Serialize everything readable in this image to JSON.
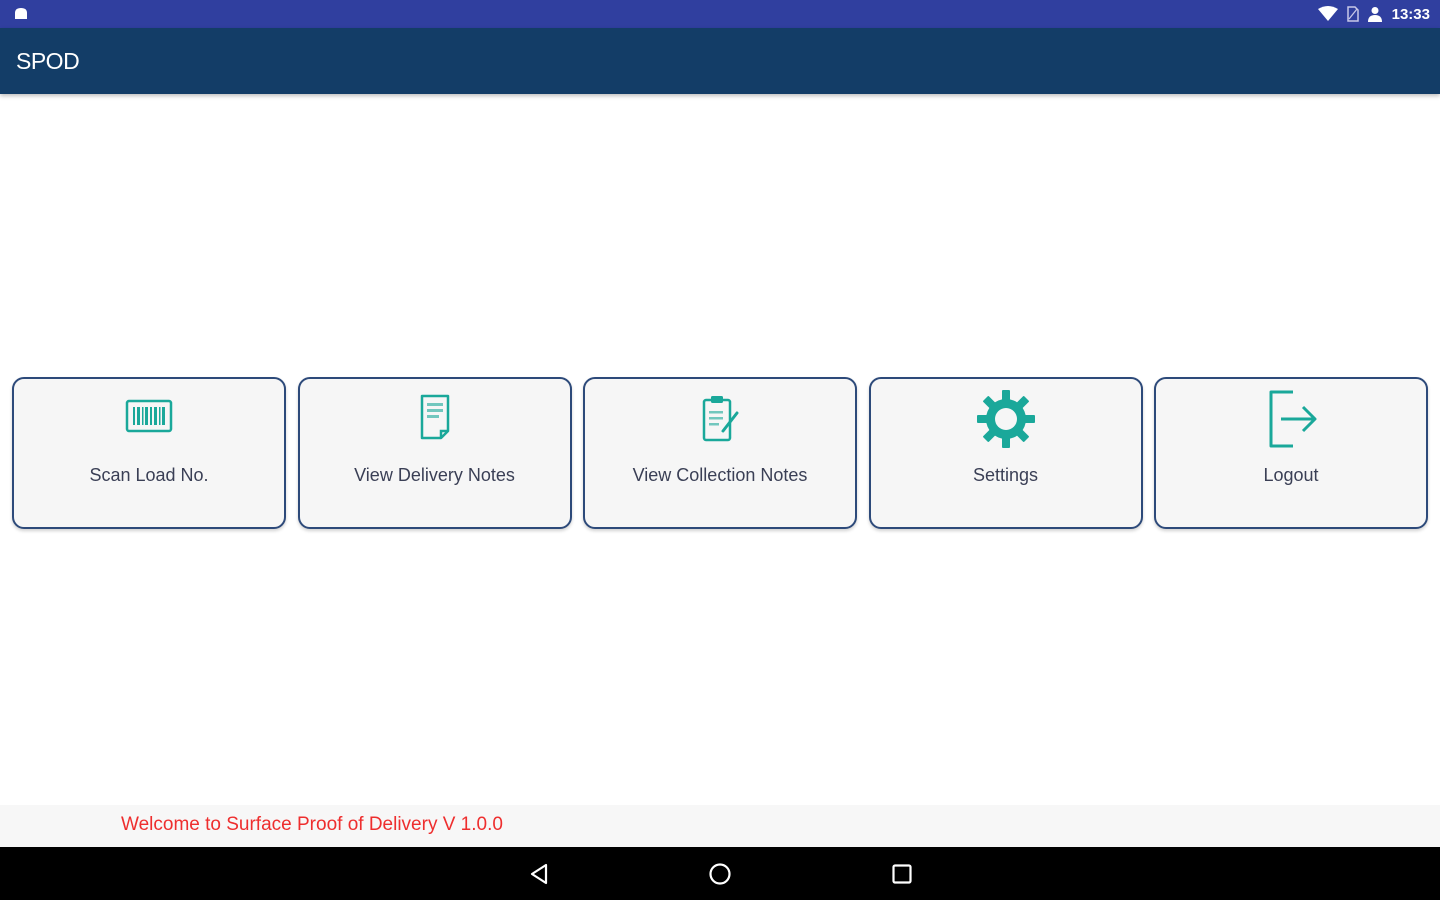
{
  "status_bar": {
    "time": "13:33",
    "icons": [
      "android-notification-icon",
      "wifi-icon",
      "no-sim-icon",
      "user-icon"
    ]
  },
  "app_bar": {
    "title": "SPOD"
  },
  "tiles": [
    {
      "label": "Scan Load No.",
      "icon": "barcode-icon"
    },
    {
      "label": "View Delivery Notes",
      "icon": "document-icon"
    },
    {
      "label": "View Collection Notes",
      "icon": "clipboard-edit-icon"
    },
    {
      "label": "Settings",
      "icon": "gear-icon"
    },
    {
      "label": "Logout",
      "icon": "logout-icon"
    }
  ],
  "footer": {
    "welcome_text": "Welcome to Surface Proof of Delivery V 1.0.0"
  },
  "nav": {
    "buttons": [
      "back-icon",
      "home-icon",
      "recents-icon"
    ]
  },
  "colors": {
    "status_bar": "#303f9f",
    "app_bar": "#133d67",
    "tile_border": "#2d4a7a",
    "icon_teal": "#1aa89a",
    "welcome_text": "#ee2e2e"
  }
}
